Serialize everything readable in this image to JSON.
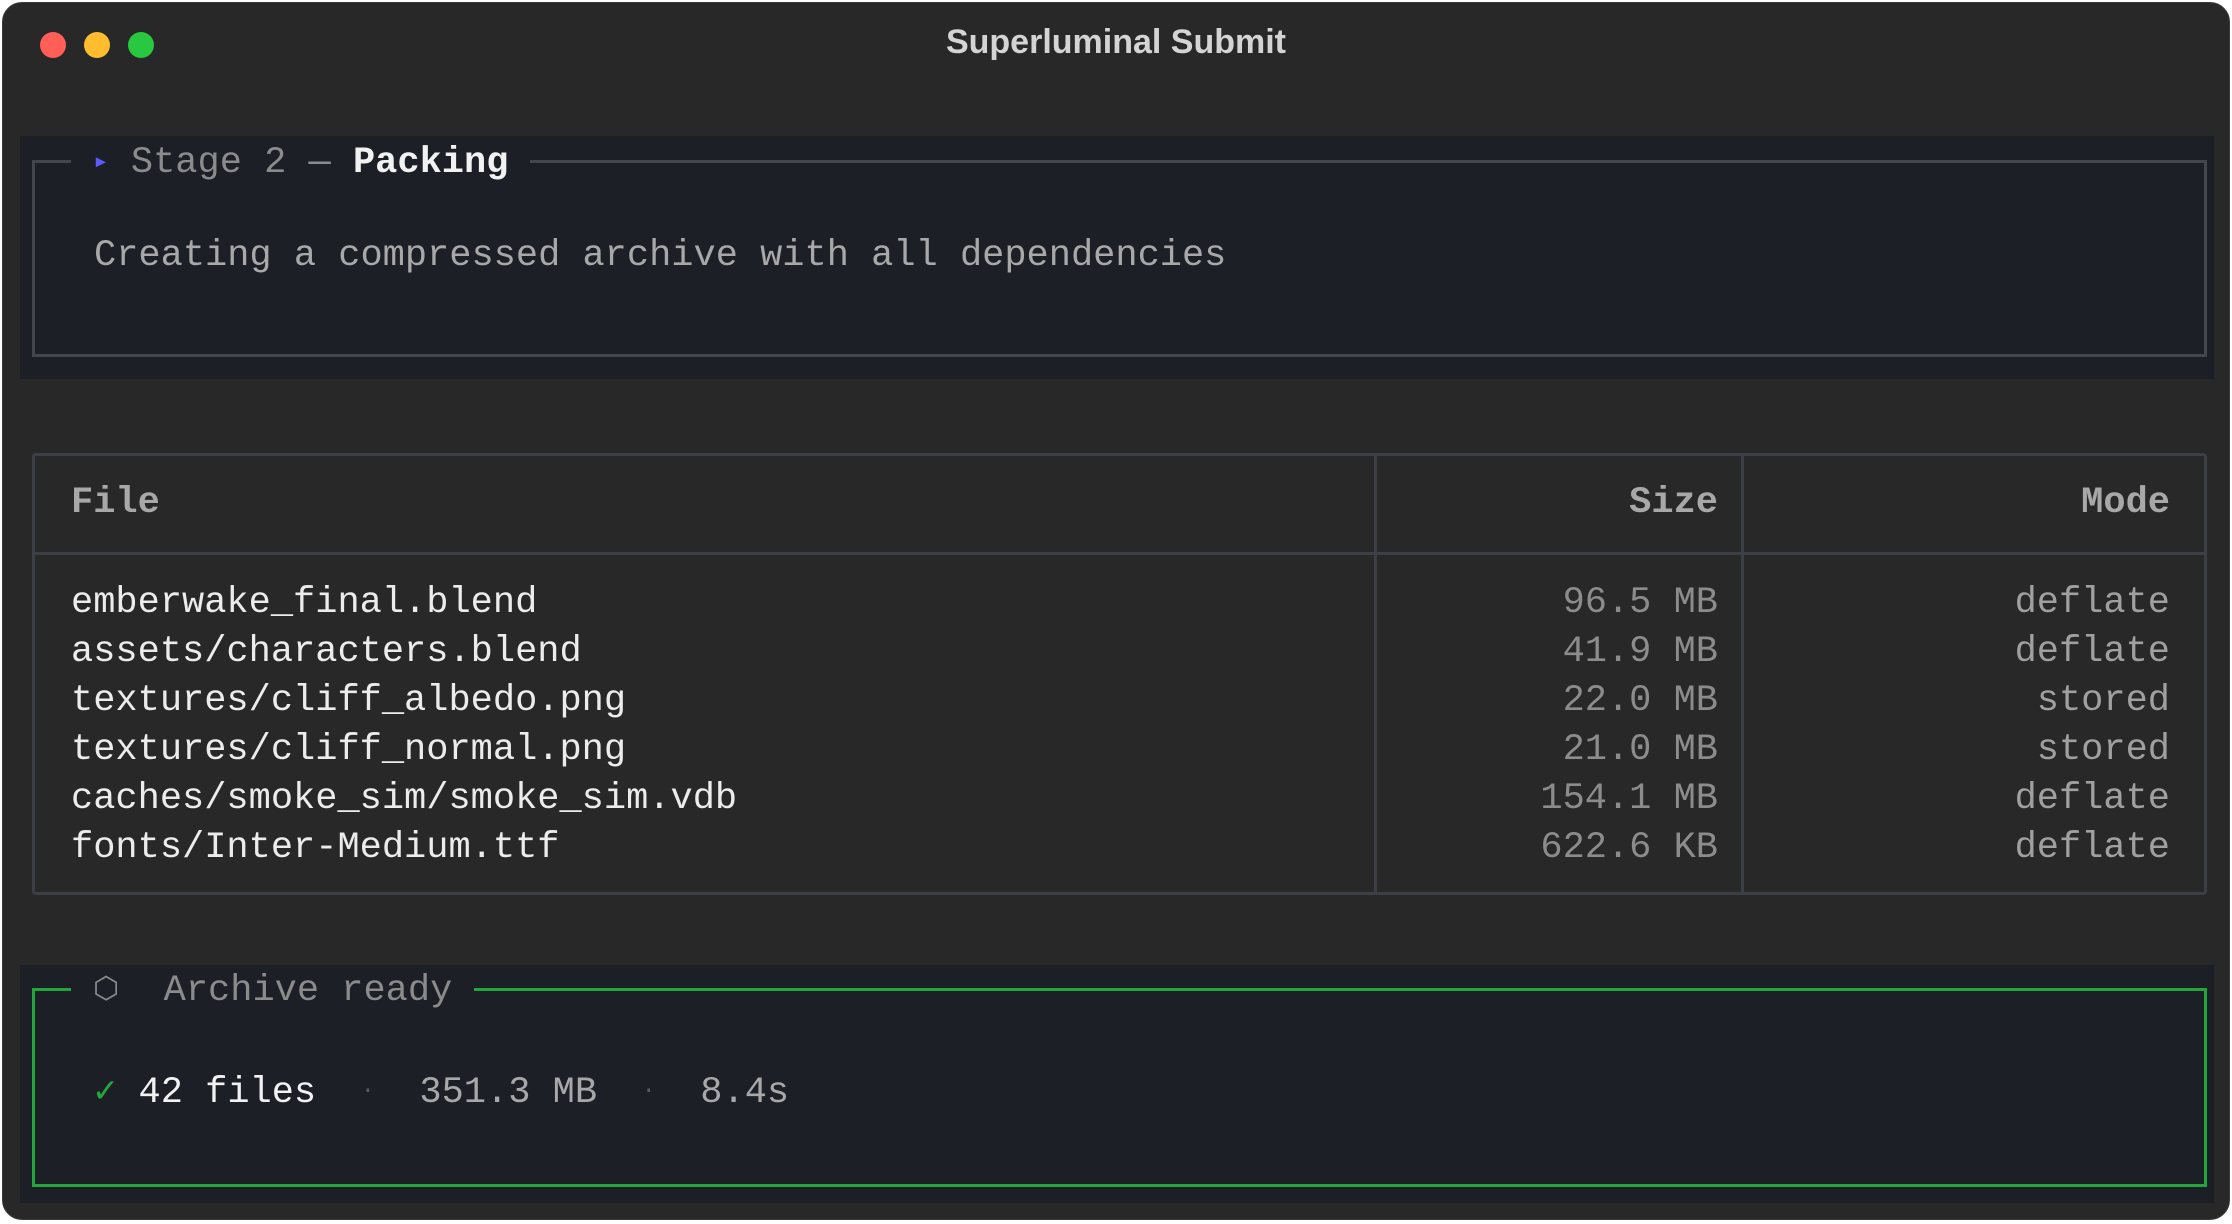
{
  "window": {
    "title": "Superluminal Submit"
  },
  "stage": {
    "arrow_icon": "▸",
    "label": "Stage 2",
    "separator": "—",
    "name": "Packing",
    "description": "Creating a compressed archive with all dependencies",
    "accent_color": "#5b5bff"
  },
  "table": {
    "headers": {
      "file": "File",
      "size": "Size",
      "mode": "Mode"
    },
    "rows": [
      {
        "file": "emberwake_final.blend",
        "size": "96.5 MB",
        "mode": "deflate"
      },
      {
        "file": "assets/characters.blend",
        "size": "41.9 MB",
        "mode": "deflate"
      },
      {
        "file": "textures/cliff_albedo.png",
        "size": "22.0 MB",
        "mode": "stored"
      },
      {
        "file": "textures/cliff_normal.png",
        "size": "21.0 MB",
        "mode": "stored"
      },
      {
        "file": "caches/smoke_sim/smoke_sim.vdb",
        "size": "154.1 MB",
        "mode": "deflate"
      },
      {
        "file": "fonts/Inter-Medium.ttf",
        "size": "622.6 KB",
        "mode": "deflate"
      }
    ]
  },
  "summary": {
    "icon": "⬡",
    "title": "Archive ready",
    "check": "✓",
    "files": "42 files",
    "bullet": "·",
    "total_size": "351.3 MB",
    "elapsed": "8.4s",
    "border_color": "#22a63c"
  }
}
